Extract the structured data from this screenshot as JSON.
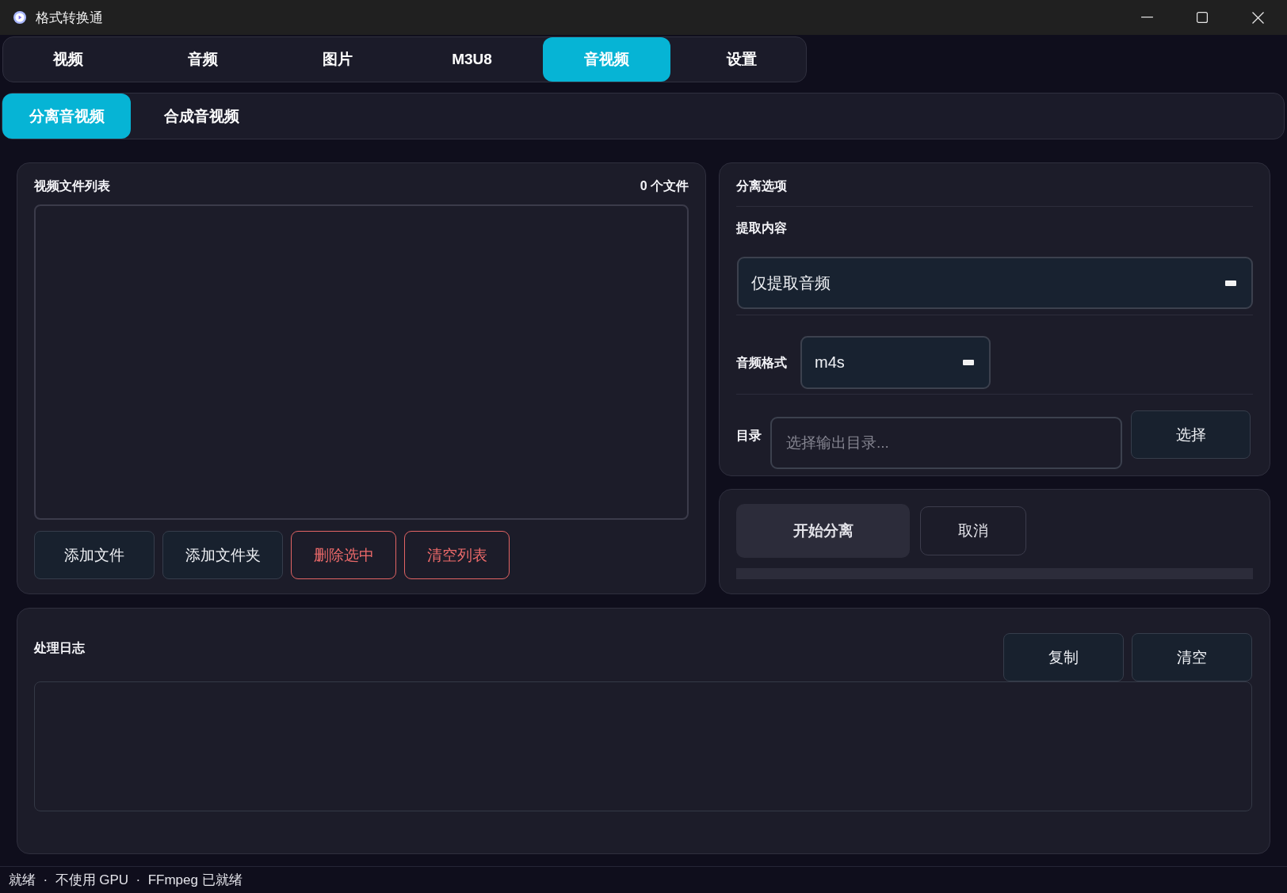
{
  "window": {
    "title": "格式转换通"
  },
  "tabs": [
    {
      "label": "视频",
      "selected": false
    },
    {
      "label": "音频",
      "selected": false
    },
    {
      "label": "图片",
      "selected": false
    },
    {
      "label": "M3U8",
      "selected": false
    },
    {
      "label": "音视频",
      "selected": true
    },
    {
      "label": "设置",
      "selected": false
    }
  ],
  "subtabs": [
    {
      "label": "分离音视频",
      "selected": true
    },
    {
      "label": "合成音视频",
      "selected": false
    }
  ],
  "file_list": {
    "title": "视频文件列表",
    "count": "0 个文件",
    "buttons": [
      {
        "label": "添加文件",
        "kind": "normal"
      },
      {
        "label": "添加文件夹",
        "kind": "normal"
      },
      {
        "label": "删除选中",
        "kind": "danger"
      },
      {
        "label": "清空列表",
        "kind": "danger"
      }
    ]
  },
  "options": {
    "title": "分离选项",
    "extract": {
      "label": "提取内容",
      "value": "仅提取音频"
    },
    "format": {
      "label": "音频格式",
      "value": "m4s"
    },
    "output_dir": {
      "label": "目录",
      "placeholder": "选择输出目录...",
      "button": "选择"
    }
  },
  "actions": {
    "buttons": [
      {
        "label": "开始分离",
        "kind": "primary"
      },
      {
        "label": "取消",
        "kind": "outline"
      }
    ],
    "progress": {
      "level": 0
    }
  },
  "log": {
    "title": "处理日志",
    "buttons": [
      {
        "label": "复制",
        "kind": "normal"
      },
      {
        "label": "清空",
        "kind": "normal"
      }
    ]
  },
  "status_bar": {
    "text": "就绪  ·  不使用 GPU  ·  FFmpeg 已就绪"
  }
}
